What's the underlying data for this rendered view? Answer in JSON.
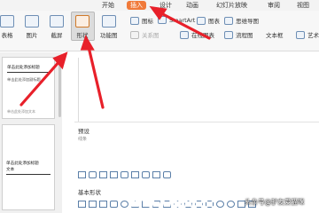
{
  "menu": {
    "items": [
      "开始",
      "插入",
      "设计",
      "动画",
      "幻灯片放映",
      "审阅",
      "视图"
    ],
    "active": "插入"
  },
  "ribbon": {
    "table": "表格",
    "image": "图片",
    "screenshot": "截屏",
    "shape": "形状",
    "function_chart": "功能图",
    "icon": "图标",
    "smartart": "SmartArt",
    "chart": "图表",
    "online_chart": "在线图表",
    "mind_map": "思维导图",
    "flowchart": "流程图",
    "textbox": "文本框",
    "wordart": "艺术",
    "relation_chart": "关系图"
  },
  "slides": {
    "slide1": {
      "title": "单击此处添加标题",
      "subtitle": "单击此处添加副标题",
      "footer": "单击此处添加文本"
    },
    "slide2": {
      "title": "单击此处添加标题",
      "title2": "文本"
    }
  },
  "dropdown": {
    "preset_heading": "预设",
    "preset_small": "线条",
    "basic_heading": "基本形状"
  },
  "watermark": "头条号@驴友爱猫咪"
}
